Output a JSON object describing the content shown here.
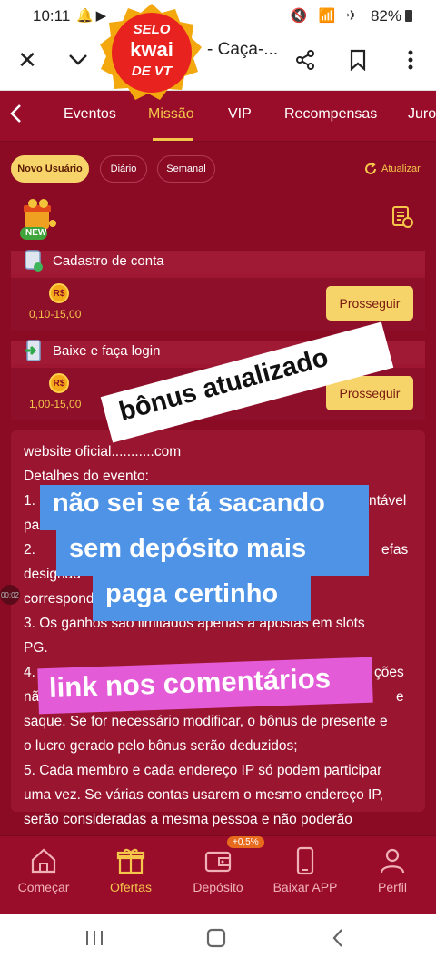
{
  "status_bar": {
    "time": "10:11",
    "battery": "82%"
  },
  "browser": {
    "title": "- Caça-..."
  },
  "badge": {
    "line1": "SELO",
    "line2": "kwai",
    "line3": "DE VT"
  },
  "tabs": [
    "Eventos",
    "Missão",
    "VIP",
    "Recompensas",
    "Juro"
  ],
  "chips": [
    "Novo Usuário",
    "Diário",
    "Semanal"
  ],
  "refresh_label": "Atualizar",
  "new_label": "NEW",
  "tasks": [
    {
      "title": "Cadastro de conta",
      "reward": "0,10-15,00",
      "button": "Prosseguir",
      "coin": "R$"
    },
    {
      "title": "Baixe e faça login",
      "reward": "1,00-15,00",
      "button": "Prosseguir",
      "coin": "R$"
    }
  ],
  "details_lines": [
    "website oficial...........com",
    "Detalhes do evento:",
    "1.",
    "pa",
    "2.",
    "designad",
    "correspond",
    "3. Os ganhos são limitados apenas a apostas em slots",
    "PG.",
    "4.",
    "nã",
    "saque. Se for necessário modificar, o bônus de presente e",
    "o lucro gerado pelo bônus serão deduzidos;",
    "5. Cada membro e cada endereço IP só podem participar",
    "uma vez. Se várias contas usarem o mesmo endereço IP,",
    "serão consideradas a mesma pessoa e não poderão"
  ],
  "details_fragments": {
    "ntavel": "ntável",
    "efas": "efas",
    "coes": "ções",
    "e": "e"
  },
  "overlays": {
    "bonus": "bônus atualizado",
    "line1": "não sei se tá sacando",
    "line2": "sem depósito  mais",
    "line3": "paga certinho",
    "link": "link nos comentários",
    "time": "00:02"
  },
  "bottom_nav": [
    {
      "label": "Começar",
      "icon": "home-icon"
    },
    {
      "label": "Ofertas",
      "icon": "gift-icon"
    },
    {
      "label": "Depósito",
      "icon": "wallet-icon"
    },
    {
      "label": "Baixar APP",
      "icon": "phone-icon"
    },
    {
      "label": "Perfil",
      "icon": "user-icon"
    }
  ],
  "deposit_badge": "+0,5%",
  "colors": {
    "primary": "#8b0b25",
    "accent": "#f5c64a",
    "button": "#f7d46a"
  }
}
